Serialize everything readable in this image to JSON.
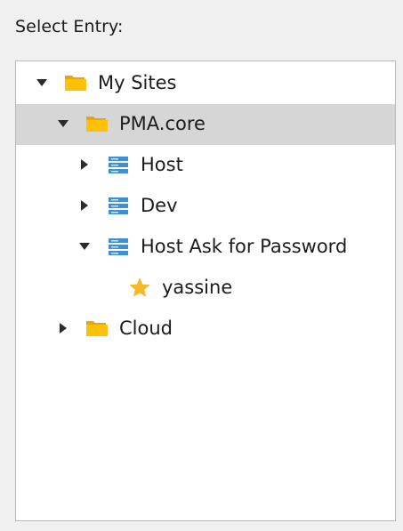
{
  "dialog": {
    "label": "Select Entry:"
  },
  "tree": {
    "nodes": [
      {
        "label": "My Sites",
        "type": "folder",
        "expanded": true,
        "selected": false
      },
      {
        "label": "PMA.core",
        "type": "folder",
        "expanded": true,
        "selected": true
      },
      {
        "label": "Host",
        "type": "server",
        "expanded": false,
        "selected": false
      },
      {
        "label": "Dev",
        "type": "server",
        "expanded": false,
        "selected": false
      },
      {
        "label": "Host Ask for Password",
        "type": "server",
        "expanded": true,
        "selected": false
      },
      {
        "label": "yassine",
        "type": "favorite",
        "expanded": null,
        "selected": false
      },
      {
        "label": "Cloud",
        "type": "folder",
        "expanded": false,
        "selected": false
      }
    ]
  },
  "colors": {
    "folder": "#ffc107",
    "server": "#3d8fd6",
    "star": "#f7b928",
    "selection": "#d6d6d6"
  }
}
